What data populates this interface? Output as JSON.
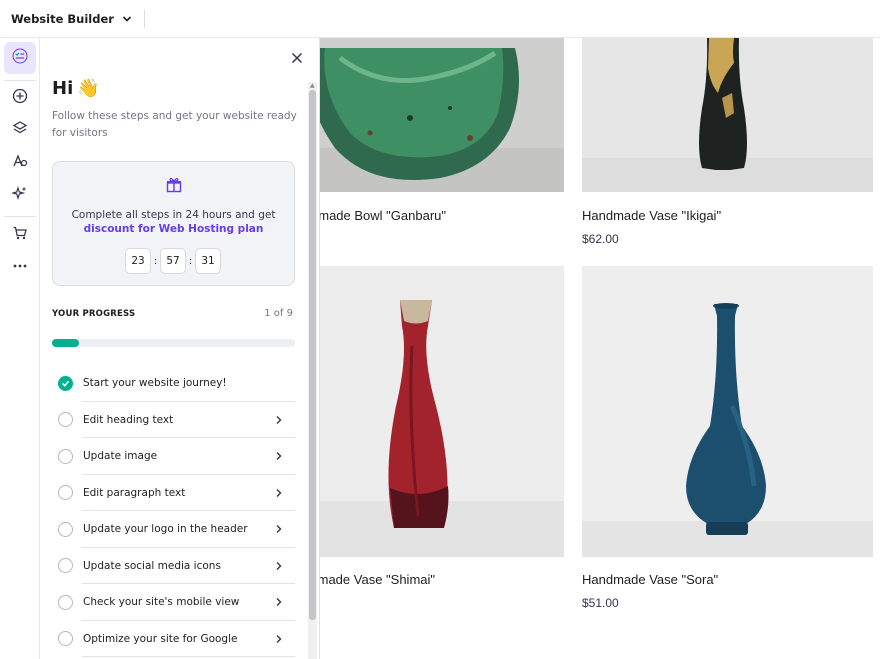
{
  "topbar": {
    "title": "Website Builder"
  },
  "rail": {
    "items": [
      {
        "icon": "checklist-icon",
        "active": true
      },
      {
        "icon": "add-circle-icon"
      },
      {
        "icon": "layers-icon"
      },
      {
        "icon": "styles-icon"
      },
      {
        "icon": "ai-sparkle-icon"
      },
      {
        "icon": "cart-icon"
      },
      {
        "icon": "more-icon"
      }
    ]
  },
  "panel": {
    "greeting": "Hi",
    "wave": "👋",
    "subtitle": "Follow these steps and get your website ready for visitors",
    "promo": {
      "line1": "Complete all steps in 24 hours and get",
      "line2": "discount for Web Hosting plan",
      "timer": {
        "hours": "23",
        "minutes": "57",
        "seconds": "31"
      }
    },
    "progress": {
      "label": "YOUR PROGRESS",
      "count": "1 of 9",
      "fraction": 0.111
    },
    "steps": [
      {
        "label": "Start your website journey!",
        "done": true
      },
      {
        "label": "Edit heading text",
        "done": false
      },
      {
        "label": "Update image",
        "done": false
      },
      {
        "label": "Edit paragraph text",
        "done": false
      },
      {
        "label": "Update your logo in the header",
        "done": false
      },
      {
        "label": "Update social media icons",
        "done": false
      },
      {
        "label": "Check your site's mobile view",
        "done": false
      },
      {
        "label": "Optimize your site for Google",
        "done": false
      }
    ]
  },
  "products": [
    {
      "name": "Handmade Bowl \"Ganbaru\"",
      "price": ""
    },
    {
      "name": "Handmade Vase \"Ikigai\"",
      "price": "$62.00"
    },
    {
      "name": "Handmade Vase \"Shimai\"",
      "price": ""
    },
    {
      "name": "Handmade Vase \"Sora\"",
      "price": "$51.00"
    }
  ],
  "colors": {
    "accent": "#673de6",
    "success": "#00b090",
    "text": "#1d1e20"
  }
}
